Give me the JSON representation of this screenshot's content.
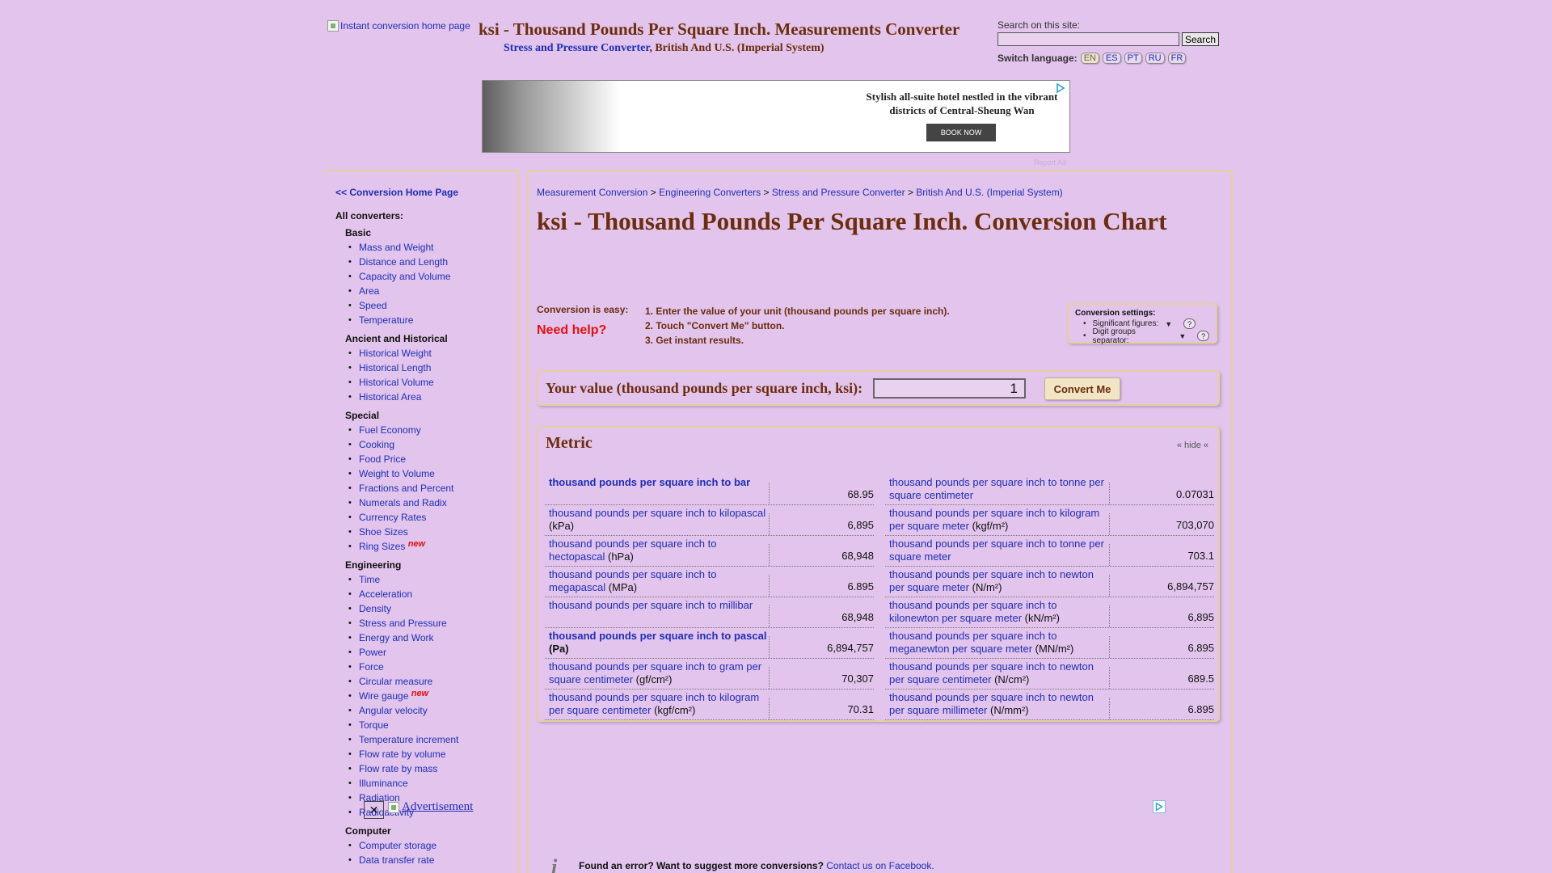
{
  "header": {
    "logo_alt": "Instant conversion home page",
    "site_title": "ksi - Thousand Pounds Per Square Inch. Measurements Converter",
    "subtitle_link": "Stress and Pressure Converter",
    "subtitle_rest": ", British And U.S. (Imperial System)",
    "search_label": "Search on this site:",
    "search_value": "",
    "search_button": "Search",
    "switch_language_label": "Switch language:",
    "languages": [
      "EN",
      "ES",
      "PT",
      "RU",
      "FR"
    ],
    "active_language": "EN"
  },
  "ad": {
    "text": "Stylish all-suite hotel nestled in the vibrant districts of Central-Sheung Wan",
    "button": "BOOK NOW",
    "report": "Report Ad",
    "ad_choices_icon": "ad-choices-icon"
  },
  "sidebar": {
    "home_link": "<< Conversion Home Page",
    "all_converters": "All converters:",
    "groups": [
      {
        "title": "Basic",
        "items": [
          "Mass and Weight",
          "Distance and Length",
          "Capacity and Volume",
          "Area",
          "Speed",
          "Temperature"
        ]
      },
      {
        "title": "Ancient and Historical",
        "items": [
          "Historical Weight",
          "Historical Length",
          "Historical Volume",
          "Historical Area"
        ]
      },
      {
        "title": "Special",
        "items": [
          "Fuel Economy",
          "Cooking",
          "Food Price",
          "Weight to Volume",
          "Fractions and Percent",
          "Numerals and Radix",
          "Currency Rates",
          "Shoe Sizes",
          "Ring Sizes"
        ]
      },
      {
        "title": "Engineering",
        "items": [
          "Time",
          "Acceleration",
          "Density",
          "Stress and Pressure",
          "Energy and Work",
          "Power",
          "Force",
          "Circular measure",
          "Wire gauge",
          "Angular velocity",
          "Torque",
          "Temperature increment",
          "Flow rate by volume",
          "Flow rate by mass",
          "Illuminance",
          "Radiation",
          "Radioactivity"
        ]
      },
      {
        "title": "Computer",
        "items": [
          "Computer storage",
          "Data transfer rate"
        ]
      }
    ],
    "new_tag": "new"
  },
  "main": {
    "breadcrumb": [
      "Measurement Conversion",
      "Engineering Converters",
      "Stress and Pressure Converter",
      "British And U.S. (Imperial System)"
    ],
    "breadcrumb_sep": " > ",
    "title": "ksi - Thousand Pounds Per Square Inch. Conversion Chart",
    "easy_label": "Conversion is easy:",
    "need_help": "Need help?",
    "steps": [
      "1. Enter the value of your unit (thousand pounds per square inch).",
      "2. Touch \"Convert Me\" button.",
      "3. Get instant results."
    ],
    "settings": {
      "title": "Conversion settings:",
      "significant_figures": "Significant figures:",
      "digit_separator": "Digit groups separator:",
      "help": "?"
    },
    "value_label": "Your value (thousand pounds per square inch, ksi):",
    "value": "1",
    "convert_button": "Convert Me",
    "metric_title": "Metric",
    "hide_label": "« hide «",
    "left_rows": [
      {
        "link": "thousand pounds per square inch to bar",
        "suffix": "",
        "value": "68.95",
        "bold": true
      },
      {
        "link": "thousand pounds per square inch to kilopascal",
        "suffix": " (kPa)",
        "value": "6,895",
        "bold": false
      },
      {
        "link": "thousand pounds per square inch to hectopascal",
        "suffix": " (hPa)",
        "value": "68,948",
        "bold": false
      },
      {
        "link": "thousand pounds per square inch to megapascal",
        "suffix": " (MPa)",
        "value": "6.895",
        "bold": false
      },
      {
        "link": "thousand pounds per square inch to millibar",
        "suffix": "",
        "value": "68,948",
        "bold": false
      },
      {
        "link": "thousand pounds per square inch to pascal",
        "suffix": " (Pa)",
        "value": "6,894,757",
        "bold": true
      },
      {
        "link": "thousand pounds per square inch to gram per square centimeter",
        "suffix": " (gf/cm²)",
        "value": "70,307",
        "bold": false
      },
      {
        "link": "thousand pounds per square inch to kilogram per square centimeter",
        "suffix": " (kgf/cm²)",
        "value": "70.31",
        "bold": false
      }
    ],
    "right_rows": [
      {
        "link": "thousand pounds per square inch to tonne per square centimeter",
        "suffix": "",
        "value": "0.07031",
        "bold": false
      },
      {
        "link": "thousand pounds per square inch to kilogram per square meter",
        "suffix": " (kgf/m²)",
        "value": "703,070",
        "bold": false
      },
      {
        "link": "thousand pounds per square inch to tonne per square meter",
        "suffix": "",
        "value": "703.1",
        "bold": false
      },
      {
        "link": "thousand pounds per square inch to newton per square meter",
        "suffix": " (N/m²)",
        "value": "6,894,757",
        "bold": false
      },
      {
        "link": "thousand pounds per square inch to kilonewton per square meter",
        "suffix": " (kN/m²)",
        "value": "6,895",
        "bold": false
      },
      {
        "link": "thousand pounds per square inch to meganewton per square meter",
        "suffix": " (MN/m²)",
        "value": "6.895",
        "bold": false
      },
      {
        "link": "thousand pounds per square inch to newton per square centimeter",
        "suffix": " (N/cm²)",
        "value": "689.5",
        "bold": false
      },
      {
        "link": "thousand pounds per square inch to newton per square millimeter",
        "suffix": " (N/mm²)",
        "value": "6.895",
        "bold": false
      }
    ],
    "advertisement": "Advertisement",
    "feedback_text": "Found an error? Want to suggest more conversions?",
    "feedback_link": "Contact us on Facebook.",
    "info_icon": "info-icon"
  }
}
